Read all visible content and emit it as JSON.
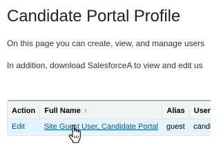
{
  "page": {
    "title": "Candidate Portal Profile",
    "intro_line_1": "On this page you can create, view, and manage users",
    "intro_line_2": "In addition, download SalesforceA to view and edit us"
  },
  "user_table": {
    "headers": {
      "action": "Action",
      "full_name": "Full Name",
      "sort_indicator": "↑",
      "alias": "Alias",
      "username": "Usernar"
    },
    "rows": [
      {
        "action": "Edit",
        "full_name": "Site Guest User, Candidate Portal",
        "alias": "guest",
        "username": "candida"
      }
    ]
  },
  "cursor": {
    "icon": "hand-pointer-icon"
  }
}
